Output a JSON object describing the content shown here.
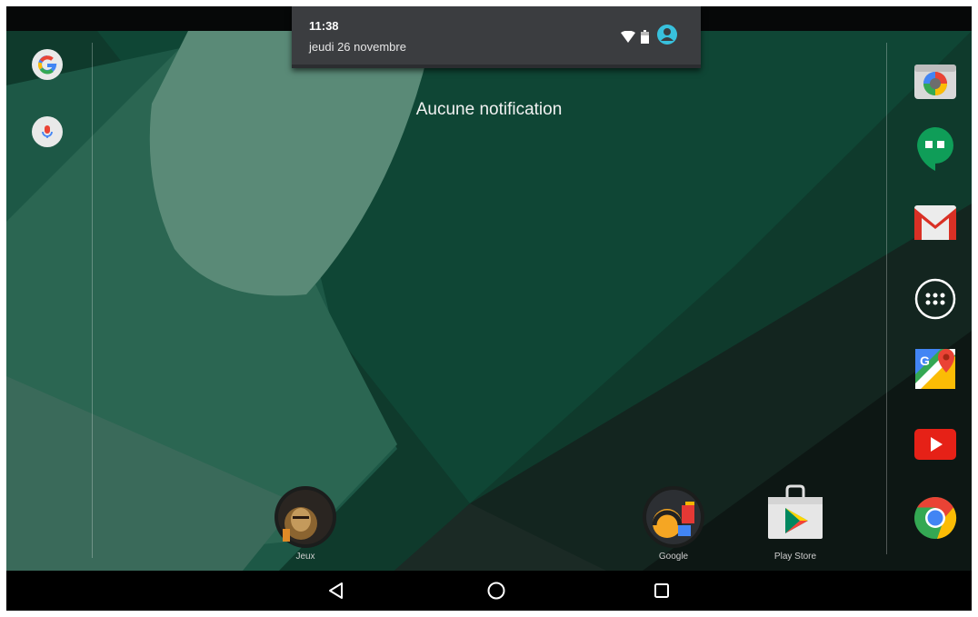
{
  "notification_shade": {
    "time": "11:38",
    "date": "jeudi 26 novembre"
  },
  "empty_message": "Aucune notification",
  "home_apps": [
    {
      "name": "Jeux"
    },
    {
      "name": "Google"
    },
    {
      "name": "Play Store"
    }
  ],
  "dock_icons": [
    "camera-icon",
    "hangouts-icon",
    "gmail-icon",
    "app-drawer-icon",
    "maps-icon",
    "youtube-icon",
    "chrome-icon"
  ],
  "colors": {
    "wallpaper_dark": "#0f3a2c",
    "wallpaper_teal": "#2e6b55",
    "shade_bg": "#3b3d40",
    "accent_cyan": "#38c1dd"
  }
}
